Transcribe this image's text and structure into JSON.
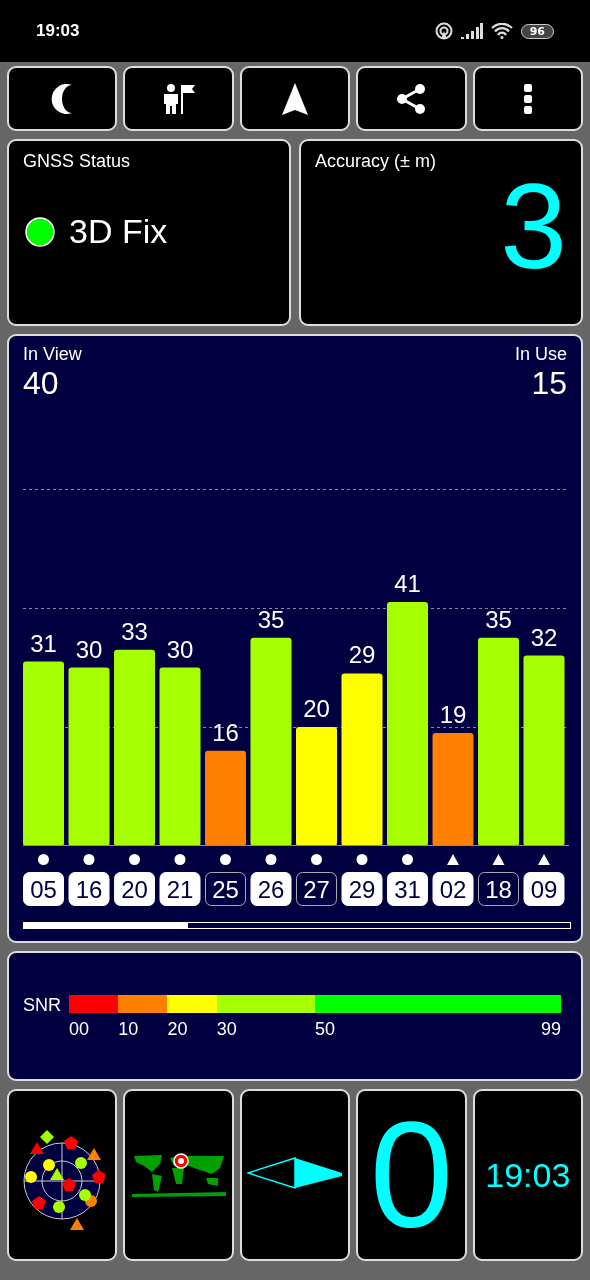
{
  "status_bar": {
    "time": "19:03",
    "battery": "96"
  },
  "toolbar": {
    "buttons": [
      {
        "kind": "moon"
      },
      {
        "kind": "person-flag"
      },
      {
        "kind": "navigation"
      },
      {
        "kind": "share"
      },
      {
        "kind": "more"
      }
    ]
  },
  "gnss_status": {
    "title": "GNSS Status",
    "value": "3D Fix"
  },
  "accuracy": {
    "title": "Accuracy (± m)",
    "value": "3"
  },
  "satellites_panel": {
    "in_view_label": "In View",
    "in_view": "40",
    "in_use_label": "In Use",
    "in_use": "15",
    "chart_data": {
      "type": "bar",
      "categories": [
        "05",
        "16",
        "20",
        "21",
        "25",
        "26",
        "27",
        "29",
        "31",
        "02",
        "18",
        "09"
      ],
      "values": [
        31,
        30,
        33,
        30,
        16,
        35,
        20,
        29,
        41,
        19,
        35,
        32
      ],
      "data_labels": true
    },
    "satellites": [
      {
        "kind": "circle",
        "in_use": true
      },
      {
        "kind": "circle",
        "in_use": true
      },
      {
        "kind": "circle",
        "in_use": true
      },
      {
        "kind": "circle",
        "in_use": true
      },
      {
        "kind": "circle",
        "in_use": false
      },
      {
        "kind": "circle",
        "in_use": true
      },
      {
        "kind": "circle",
        "in_use": false
      },
      {
        "kind": "circle",
        "in_use": true
      },
      {
        "kind": "circle",
        "in_use": true
      },
      {
        "kind": "triangle",
        "in_use": true
      },
      {
        "kind": "triangle",
        "in_use": false
      },
      {
        "kind": "triangle",
        "in_use": true
      }
    ]
  },
  "snr_legend": {
    "label": "SNR",
    "end": "99",
    "segments": [
      {
        "start": "00",
        "color": "#ff0000"
      },
      {
        "start": "10",
        "color": "#ff8000"
      },
      {
        "start": "20",
        "color": "#ffff00"
      },
      {
        "start": "30",
        "color": "#a6ff00"
      },
      {
        "start": "50",
        "color": "#00ff00"
      }
    ]
  },
  "bottom_tiles": [
    {
      "kind": "skyplot"
    },
    {
      "kind": "map"
    },
    {
      "kind": "compass"
    },
    {
      "kind": "text",
      "value": "0"
    },
    {
      "kind": "clock",
      "value": "19:03"
    }
  ]
}
